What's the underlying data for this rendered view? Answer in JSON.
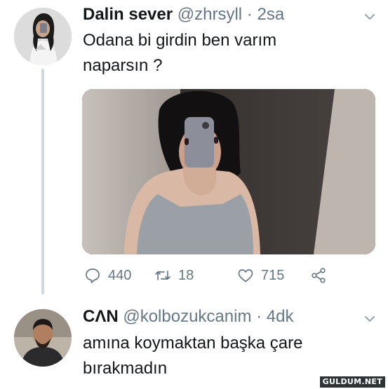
{
  "tweets": [
    {
      "name": "Dalin sever",
      "handle": "@zhrsyll",
      "separator": "·",
      "time": "2sa",
      "text": "Odana bi girdin ben varım\nnaparsın ?",
      "actions": {
        "replies": "440",
        "retweets": "18",
        "likes": "715"
      }
    },
    {
      "name": "CΛN",
      "handle": "@kolbozukcanim",
      "separator": "·",
      "time": "4dk",
      "text": "amına koymaktan başka çare\nbırakmadın"
    }
  ],
  "icons": {
    "chevron": "chevron-down-icon",
    "reply": "speech-bubble-icon",
    "retweet": "retweet-arrows-icon",
    "like": "heart-icon",
    "share": "share-nodes-icon"
  },
  "colors": {
    "text": "#14171a",
    "secondary": "#657786",
    "thread_line": "#cfd9de"
  },
  "watermark": "GULDUM.NET"
}
